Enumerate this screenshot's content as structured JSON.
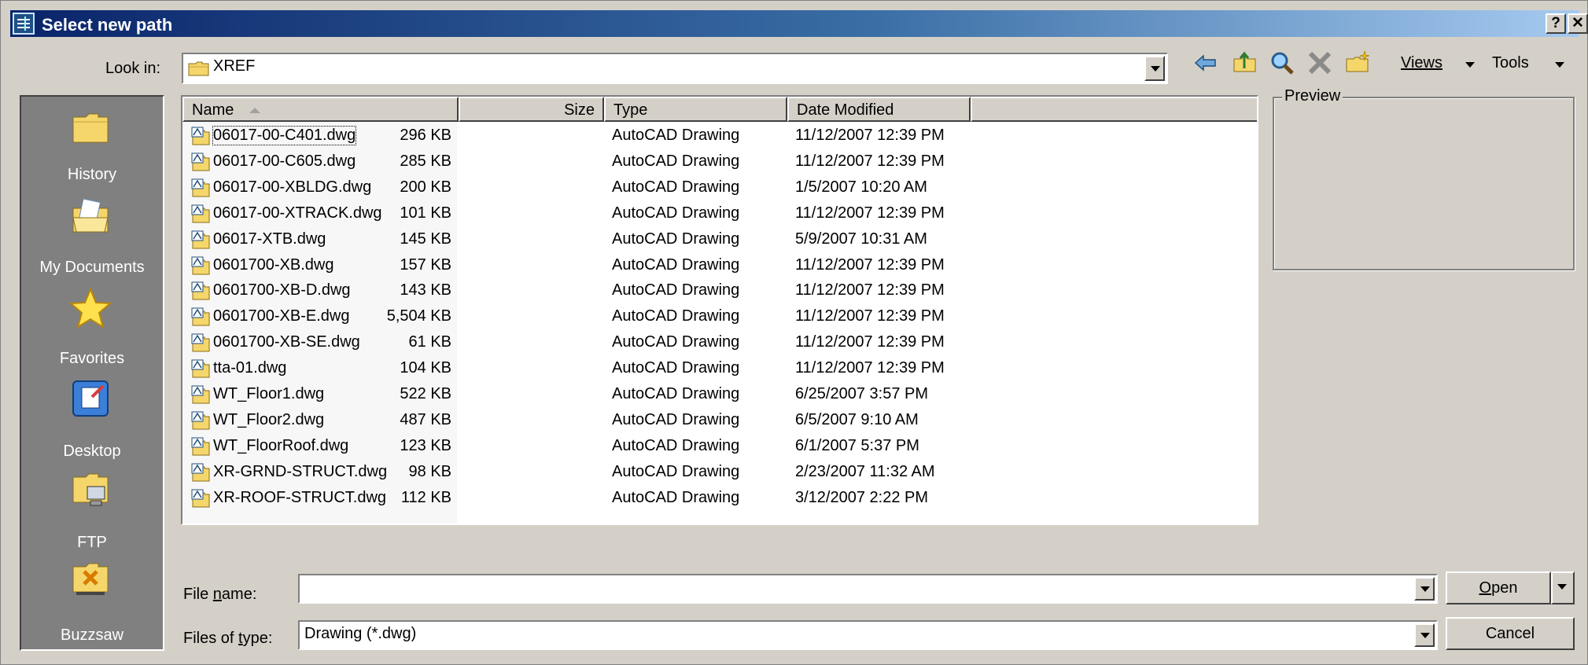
{
  "window": {
    "title": "Select new path",
    "help_label": "?",
    "close_label": "✕"
  },
  "toolbar": {
    "look_in_label": "Look in:",
    "look_in_value": "XREF",
    "views_label": "Views",
    "tools_label": "Tools"
  },
  "places": [
    {
      "label": "History",
      "icon": "history-folder-icon"
    },
    {
      "label": "My Documents",
      "icon": "my-documents-icon"
    },
    {
      "label": "Favorites",
      "icon": "favorites-star-icon"
    },
    {
      "label": "Desktop",
      "icon": "desktop-icon"
    },
    {
      "label": "FTP",
      "icon": "ftp-icon"
    },
    {
      "label": "Buzzsaw",
      "icon": "buzzsaw-icon"
    }
  ],
  "columns": {
    "name": "Name",
    "size": "Size",
    "type": "Type",
    "date": "Date Modified"
  },
  "files": [
    {
      "name": "06017-00-C401.dwg",
      "size": "296 KB",
      "type": "AutoCAD Drawing",
      "date": "11/12/2007 12:39 PM"
    },
    {
      "name": "06017-00-C605.dwg",
      "size": "285 KB",
      "type": "AutoCAD Drawing",
      "date": "11/12/2007 12:39 PM"
    },
    {
      "name": "06017-00-XBLDG.dwg",
      "size": "200 KB",
      "type": "AutoCAD Drawing",
      "date": "1/5/2007 10:20 AM"
    },
    {
      "name": "06017-00-XTRACK.dwg",
      "size": "101 KB",
      "type": "AutoCAD Drawing",
      "date": "11/12/2007 12:39 PM"
    },
    {
      "name": "06017-XTB.dwg",
      "size": "145 KB",
      "type": "AutoCAD Drawing",
      "date": "5/9/2007 10:31 AM"
    },
    {
      "name": "0601700-XB.dwg",
      "size": "157 KB",
      "type": "AutoCAD Drawing",
      "date": "11/12/2007 12:39 PM"
    },
    {
      "name": "0601700-XB-D.dwg",
      "size": "143 KB",
      "type": "AutoCAD Drawing",
      "date": "11/12/2007 12:39 PM"
    },
    {
      "name": "0601700-XB-E.dwg",
      "size": "5,504 KB",
      "type": "AutoCAD Drawing",
      "date": "11/12/2007 12:39 PM"
    },
    {
      "name": "0601700-XB-SE.dwg",
      "size": "61 KB",
      "type": "AutoCAD Drawing",
      "date": "11/12/2007 12:39 PM"
    },
    {
      "name": "tta-01.dwg",
      "size": "104 KB",
      "type": "AutoCAD Drawing",
      "date": "11/12/2007 12:39 PM"
    },
    {
      "name": "WT_Floor1.dwg",
      "size": "522 KB",
      "type": "AutoCAD Drawing",
      "date": "6/25/2007 3:57 PM"
    },
    {
      "name": "WT_Floor2.dwg",
      "size": "487 KB",
      "type": "AutoCAD Drawing",
      "date": "6/5/2007 9:10 AM"
    },
    {
      "name": "WT_FloorRoof.dwg",
      "size": "123 KB",
      "type": "AutoCAD Drawing",
      "date": "6/1/2007 5:37 PM"
    },
    {
      "name": "XR-GRND-STRUCT.dwg",
      "size": "98 KB",
      "type": "AutoCAD Drawing",
      "date": "2/23/2007 11:32 AM"
    },
    {
      "name": "XR-ROOF-STRUCT.dwg",
      "size": "112 KB",
      "type": "AutoCAD Drawing",
      "date": "3/12/2007 2:22 PM"
    }
  ],
  "preview": {
    "title": "Preview"
  },
  "bottom": {
    "file_name_label": "File name:",
    "file_name_value": "",
    "file_type_label": "Files of type:",
    "file_type_value": "Drawing (*.dwg)",
    "open_label": "Open",
    "cancel_label": "Cancel"
  },
  "colors": {
    "titlebar_start": "#0a246a",
    "titlebar_end": "#a6caf0",
    "face": "#d4d0c8",
    "places_bg": "#808080"
  }
}
